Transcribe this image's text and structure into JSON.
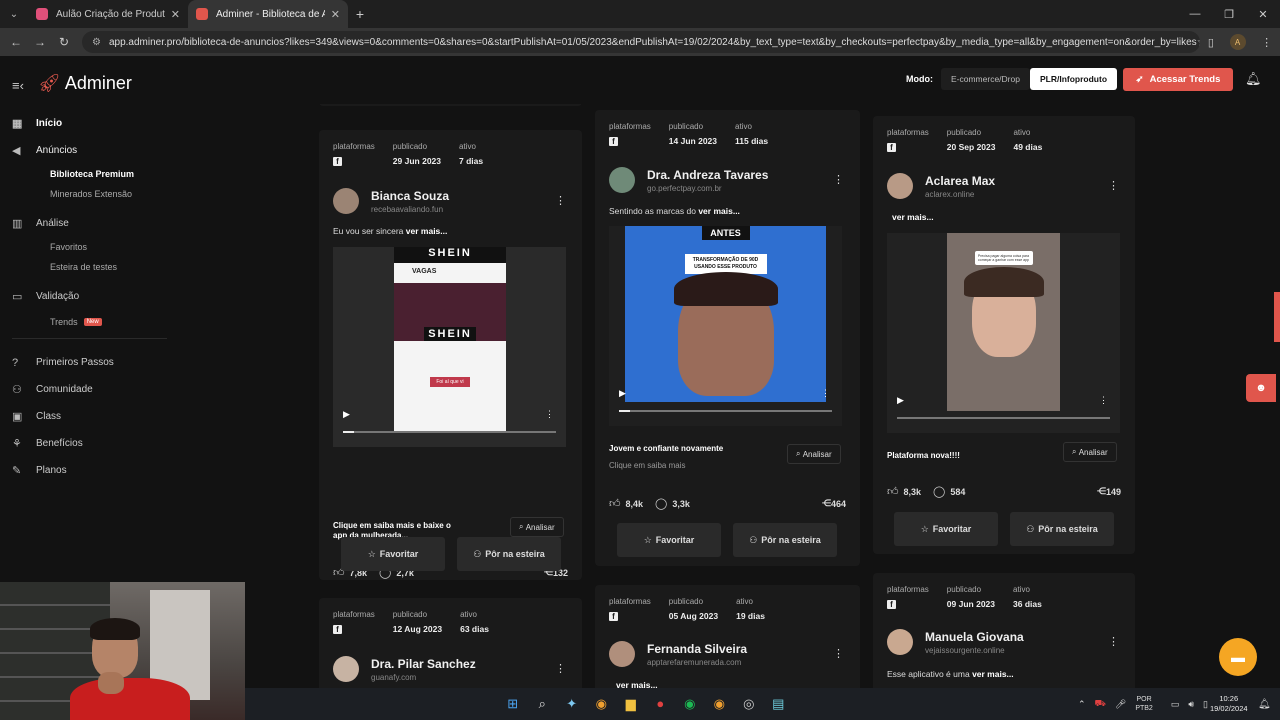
{
  "browser": {
    "tabs": [
      {
        "title": "Aulão Criação de Produto do Ze",
        "color": "#e0507a"
      },
      {
        "title": "Adminer - Biblioteca de Anúncios",
        "color": "#e0564c"
      }
    ],
    "url": "app.adminer.pro/biblioteca-de-anuncios?likes=349&views=0&comments=0&shares=0&startPublishAt=01/05/2023&endPublishAt=19/02/2024&by_text_type=text&by_checkouts=perfectpay&by_media_type=all&by_engagement=on&order_by=likes",
    "profile_initial": "A"
  },
  "header": {
    "logo": "Adminer",
    "mode_label": "Modo:",
    "mode_options": [
      "E-commerce/Drop",
      "PLR/Infoproduto"
    ],
    "mode_selected": "PLR/Infoproduto",
    "trends_button": "Acessar Trends"
  },
  "sidebar": {
    "items": [
      {
        "label": "Início",
        "icon": "grid-icon"
      },
      {
        "label": "Anúncios",
        "icon": "megaphone-icon"
      },
      {
        "label": "Análise",
        "icon": "chart-icon"
      },
      {
        "label": "Validação",
        "icon": "monitor-icon"
      },
      {
        "label": "Primeiros Passos",
        "icon": "help-icon"
      },
      {
        "label": "Comunidade",
        "icon": "people-icon"
      },
      {
        "label": "Class",
        "icon": "class-icon"
      },
      {
        "label": "Benefícios",
        "icon": "gift-icon"
      },
      {
        "label": "Planos",
        "icon": "edit-icon"
      }
    ],
    "anuncios_sub": [
      "Biblioteca Premium",
      "Minerados Extensão"
    ],
    "analise_sub": [
      "Favoritos",
      "Esteira de testes"
    ],
    "validacao_sub": [
      "Trends"
    ],
    "new_badge": "New"
  },
  "labels": {
    "plataformas": "plataformas",
    "publicado": "publicado",
    "ativo": "ativo",
    "ver_mais": "ver mais...",
    "analisar": "Analisar",
    "favoritar": "Favoritar",
    "esteira": "Pôr na esteira",
    "fb": "f"
  },
  "cards": [
    {
      "published": "29 Jun 2023",
      "active": "7 dias",
      "author": "Bianca Souza",
      "domain": "recebaavaliando.fun",
      "text": "Eu vou ser sincera",
      "media_top": "SHEIN",
      "media_sub": "VAGAS",
      "media_mid": "SHEIN",
      "media_bottom": "Foi aí que vi",
      "cta": "Clique em saiba mais e baixe o app da mulherada...",
      "likes": "7,8k",
      "comments": "2,7k",
      "shares": "132",
      "progress": 0.05
    },
    {
      "published": "14 Jun 2023",
      "active": "115 dias",
      "author": "Dra. Andreza Tavares",
      "domain": "go.perfectpay.com.br",
      "text": "Sentindo as marcas do",
      "media_top": "ANTES",
      "media_sub": "TRANSFORMAÇÃO DE 90D USANDO ESSE PRODUTO",
      "cta": "Jovem e confiante novamente",
      "cta_sub": "Clique em saiba mais",
      "likes": "8,4k",
      "comments": "3,3k",
      "shares": "464",
      "progress": 0.05
    },
    {
      "published": "20 Sep 2023",
      "active": "49 dias",
      "author": "Aclarea Max",
      "domain": "aclarex.online",
      "media_caption": "Precisa pagar alguma coisa para começar a ganhar com esse app",
      "cta": "Plataforma nova!!!!",
      "likes": "8,3k",
      "comments": "584",
      "shares": "149",
      "progress": 0.0
    },
    {
      "published": "12 Aug 2023",
      "active": "63 dias",
      "author": "Dra. Pilar Sanchez",
      "domain": "guanafy.com"
    },
    {
      "published": "05 Aug 2023",
      "active": "19 dias",
      "author": "Fernanda Silveira",
      "domain": "apptarefaremunerada.com",
      "text": ""
    },
    {
      "published": "09 Jun 2023",
      "active": "36 dias",
      "author": "Manuela Giovana",
      "domain": "vejaissourgente.online",
      "text": "Esse aplicativo é uma"
    }
  ],
  "taskbar": {
    "lang": "POR",
    "lang_sub": "PTB2",
    "time": "10:26",
    "date": "19/02/2024"
  }
}
